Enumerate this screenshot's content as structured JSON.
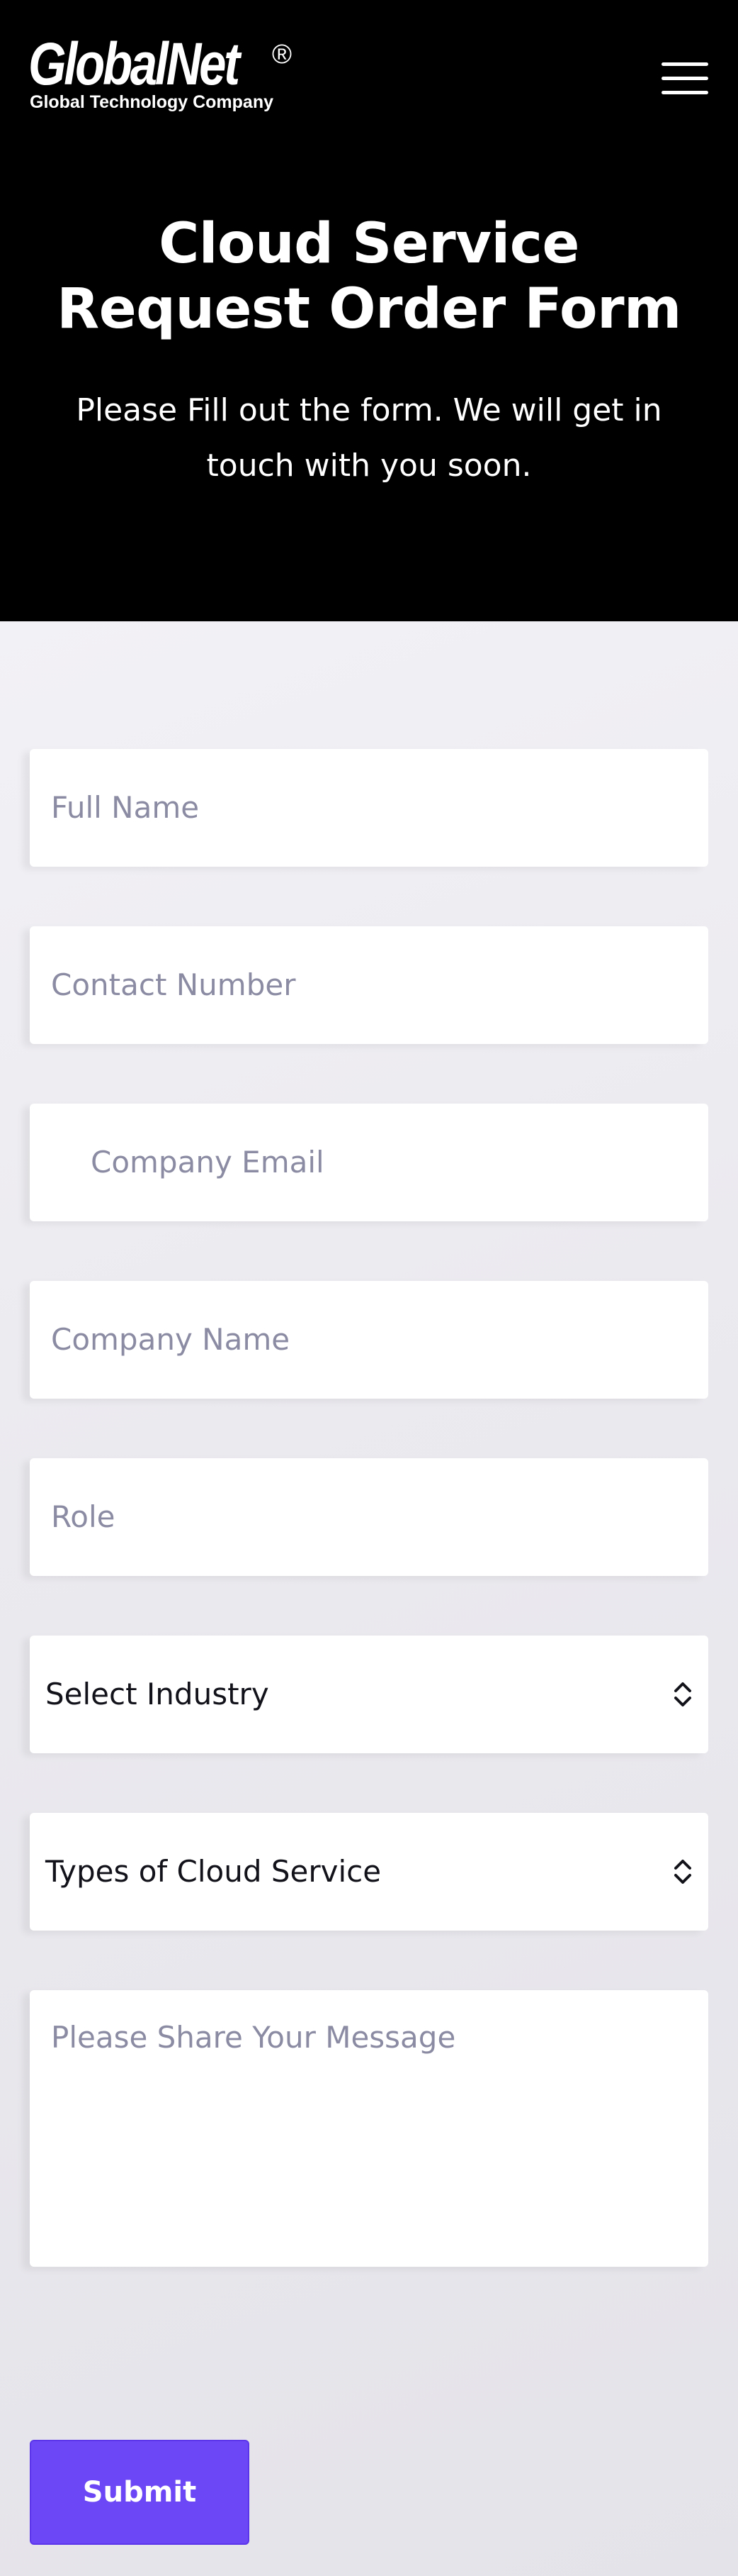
{
  "header": {
    "logo_name": "GlobalNet",
    "logo_registered": "®",
    "logo_tagline": "Global Technology Company",
    "menu_icon": "hamburger-menu-icon"
  },
  "hero": {
    "title": "Cloud Service Request Order Form",
    "subtitle": "Please Fill out the form. We will get in touch with you soon."
  },
  "form": {
    "full_name_placeholder": "Full Name",
    "contact_number_placeholder": "Contact Number",
    "company_email_placeholder": "Company Email",
    "company_name_placeholder": "Company Name",
    "role_placeholder": "Role",
    "industry_select_value": "Select Industry",
    "cloud_service_select_value": "Types of Cloud Service",
    "message_placeholder": "Please Share Your Message",
    "submit_label": "Submit",
    "select_icon": "chevron-up-down-icon"
  },
  "colors": {
    "hero_bg": "#000000",
    "accent": "#6b47f5",
    "placeholder": "#8b8ca3"
  }
}
